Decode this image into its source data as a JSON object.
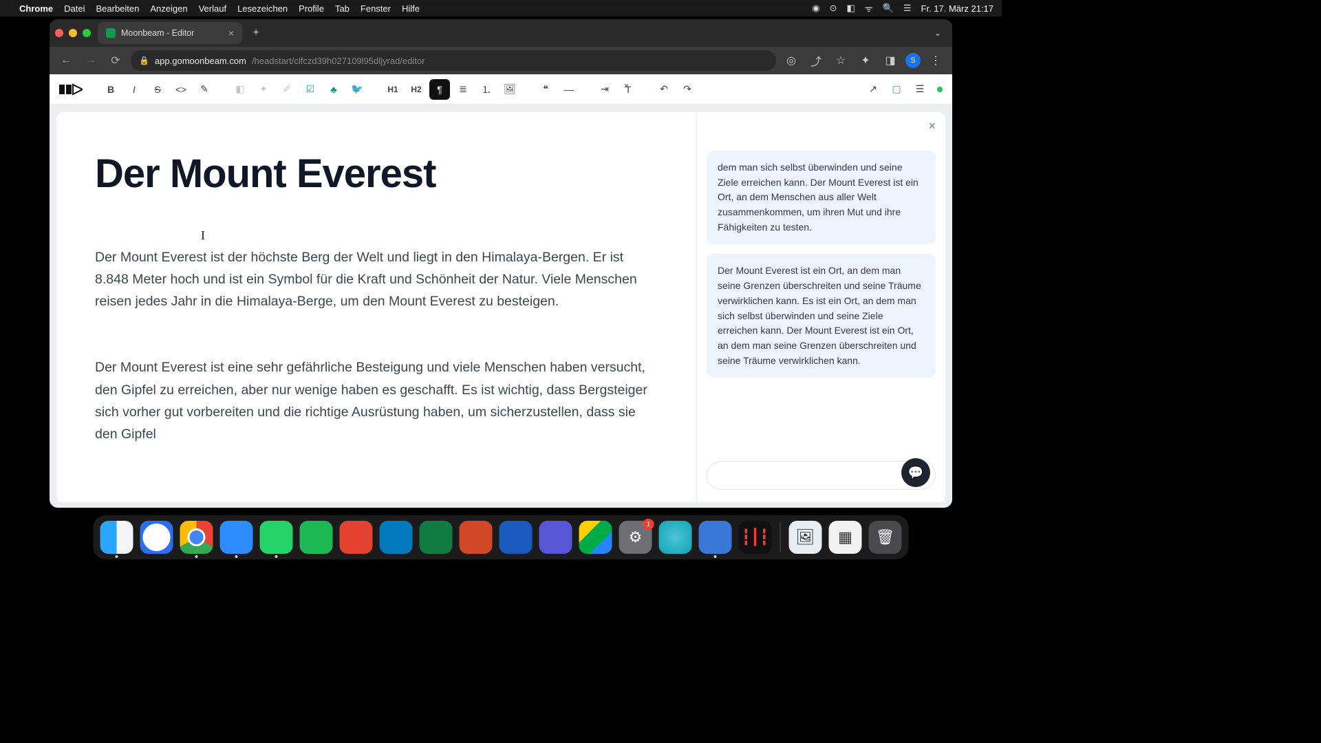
{
  "menubar": {
    "app": "Chrome",
    "items": [
      "Datei",
      "Bearbeiten",
      "Anzeigen",
      "Verlauf",
      "Lesezeichen",
      "Profile",
      "Tab",
      "Fenster",
      "Hilfe"
    ],
    "clock": "Fr. 17. März  21:17"
  },
  "browser": {
    "tab_title": "Moonbeam - Editor",
    "url_host": "app.gomoonbeam.com",
    "url_path": "/headstart/clfczd39h027109l95dljyrad/editor",
    "profile_initial": "S"
  },
  "toolbar": {
    "h1": "H1",
    "h2": "H2"
  },
  "document": {
    "title": "Der Mount Everest",
    "cursor_glyph": "I",
    "p1": "Der Mount Everest ist der höchste Berg der Welt und liegt in den Himalaya-Bergen. Er ist 8.848 Meter hoch und ist ein Symbol für die Kraft und Schönheit der Natur. Viele Menschen reisen jedes Jahr in die Himalaya-Berge, um den Mount Everest zu besteigen.",
    "p2": "Der Mount Everest ist eine sehr gefährliche Besteigung und viele Menschen haben versucht, den Gipfel zu erreichen, aber nur wenige haben es geschafft. Es ist wichtig, dass Bergsteiger sich vorher gut vorbereiten und die richtige Ausrüstung haben, um sicherzustellen, dass sie den Gipfel"
  },
  "side": {
    "msg1": "dem man sich selbst überwinden und seine Ziele erreichen kann. Der Mount Everest ist ein Ort, an dem Menschen aus aller Welt zusammenkommen, um ihren Mut und ihre Fähigkeiten zu testen.",
    "msg2": "Der Mount Everest ist ein Ort, an dem man seine Grenzen überschreiten und seine Träume verwirklichen kann. Es ist ein Ort, an dem man sich selbst überwinden und seine Ziele erreichen kann. Der Mount Everest ist ein Ort, an dem man seine Grenzen überschreiten und seine Träume verwirklichen kann.",
    "input_placeholder": ""
  },
  "dock": {
    "settings_badge": "1"
  }
}
